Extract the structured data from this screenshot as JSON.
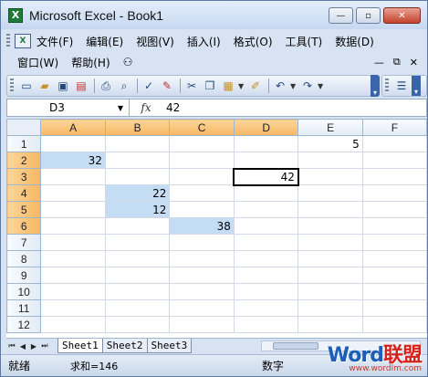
{
  "window": {
    "title": "Microsoft Excel - Book1",
    "icon": "X"
  },
  "caption_buttons": {
    "minimize": "—",
    "maximize": "▫",
    "close": "✕"
  },
  "menu_row1": [
    "文件(F)",
    "编辑(E)",
    "视图(V)",
    "插入(I)",
    "格式(O)",
    "工具(T)",
    "数据(D)"
  ],
  "menu_row2": [
    "窗口(W)",
    "帮助(H)"
  ],
  "doc_controls": {
    "minimize": "—",
    "restore": "⧉",
    "close": "✕"
  },
  "formula_bar": {
    "name_box": "D3",
    "fx": "fx",
    "value": "42"
  },
  "columns": [
    "A",
    "B",
    "C",
    "D",
    "E",
    "F"
  ],
  "rows": [
    {
      "n": "1",
      "cells": [
        "",
        "",
        "",
        "",
        "5",
        ""
      ]
    },
    {
      "n": "2",
      "cells": [
        "32",
        "",
        "",
        "",
        "",
        ""
      ]
    },
    {
      "n": "3",
      "cells": [
        "",
        "",
        "",
        "42",
        "",
        ""
      ]
    },
    {
      "n": "4",
      "cells": [
        "",
        "22",
        "",
        "",
        "",
        ""
      ]
    },
    {
      "n": "5",
      "cells": [
        "",
        "12",
        "",
        "",
        "",
        ""
      ]
    },
    {
      "n": "6",
      "cells": [
        "",
        "",
        "38",
        "",
        "",
        ""
      ]
    },
    {
      "n": "7",
      "cells": [
        "",
        "",
        "",
        "",
        "",
        ""
      ]
    },
    {
      "n": "8",
      "cells": [
        "",
        "",
        "",
        "",
        "",
        ""
      ]
    },
    {
      "n": "9",
      "cells": [
        "",
        "",
        "",
        "",
        "",
        ""
      ]
    },
    {
      "n": "10",
      "cells": [
        "",
        "",
        "",
        "",
        "",
        ""
      ]
    },
    {
      "n": "11",
      "cells": [
        "",
        "",
        "",
        "",
        "",
        ""
      ]
    },
    {
      "n": "12",
      "cells": [
        "",
        "",
        "",
        "",
        "",
        ""
      ]
    }
  ],
  "sheet_tabs": [
    "Sheet1",
    "Sheet2",
    "Sheet3"
  ],
  "status": {
    "ready": "就绪",
    "sum": "求和=146",
    "mode": "数字"
  },
  "watermark": {
    "word": "Word",
    "cn": "联盟",
    "url": "www.wordlm.com"
  },
  "colors": {
    "selection": "#c5dcf5",
    "header_selected": "#f7b763",
    "title_bar": "#c6d8f0"
  }
}
